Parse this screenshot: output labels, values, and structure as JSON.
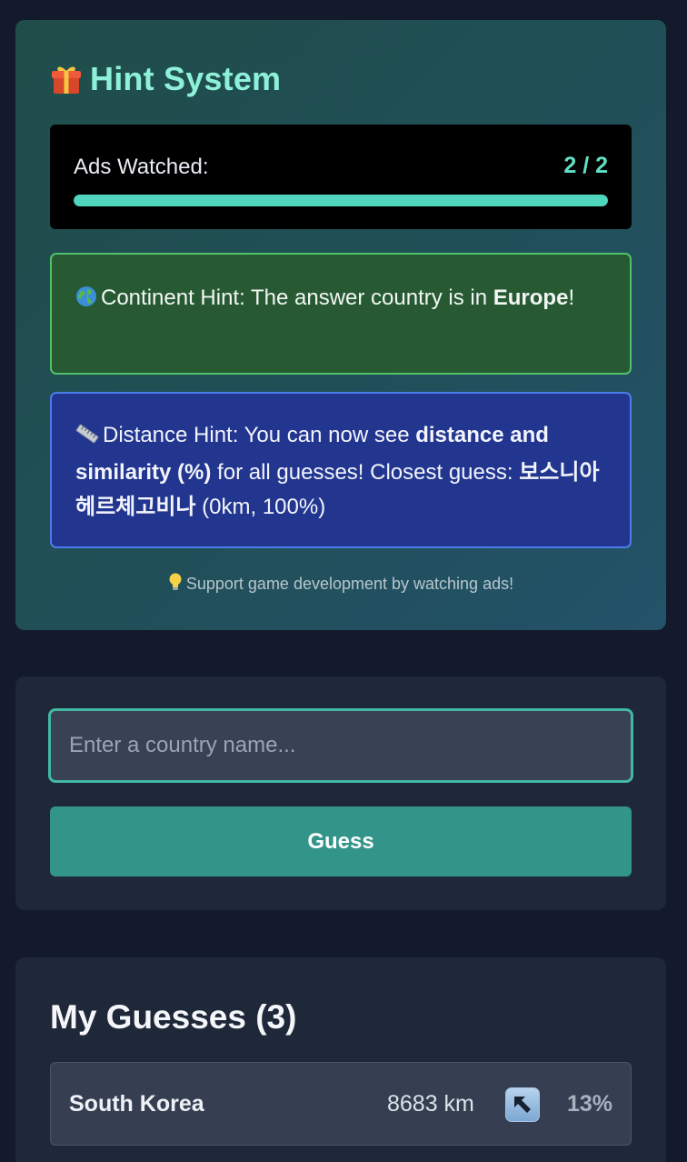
{
  "hint_system": {
    "title": "Hint System",
    "title_icon": "gift-icon",
    "ads": {
      "label": "Ads Watched:",
      "count_text": "2 / 2",
      "watched": 2,
      "total": 2,
      "progress_fraction": 1.0
    },
    "continent_hint": {
      "icon": "globe-icon",
      "prefix": "Continent Hint: The answer country is in ",
      "continent": "Europe",
      "suffix": "!"
    },
    "distance_hint": {
      "icon": "ruler-icon",
      "prefix": "Distance Hint: You can now see ",
      "emphasis": "distance and similarity (%)",
      "middle": " for all guesses! Closest guess: ",
      "closest_country": "보스니아 헤르체고비나",
      "closest_detail": " (0km, 100%)"
    },
    "support": {
      "icon": "lightbulb-icon",
      "text": "Support game development by watching ads!"
    }
  },
  "guess_form": {
    "placeholder": "Enter a country name...",
    "value": "",
    "button_label": "Guess"
  },
  "guesses": {
    "title": "My Guesses (3)",
    "items": [
      {
        "country": "South Korea",
        "distance": "8683 km",
        "direction_icon": "arrow-up-left-icon",
        "similarity": "13%"
      }
    ]
  },
  "colors": {
    "accent": "#4fd6bd",
    "title": "#8ef0d8",
    "continent_bg": "#275a33",
    "distance_bg": "#23368f",
    "button": "#33958a"
  }
}
